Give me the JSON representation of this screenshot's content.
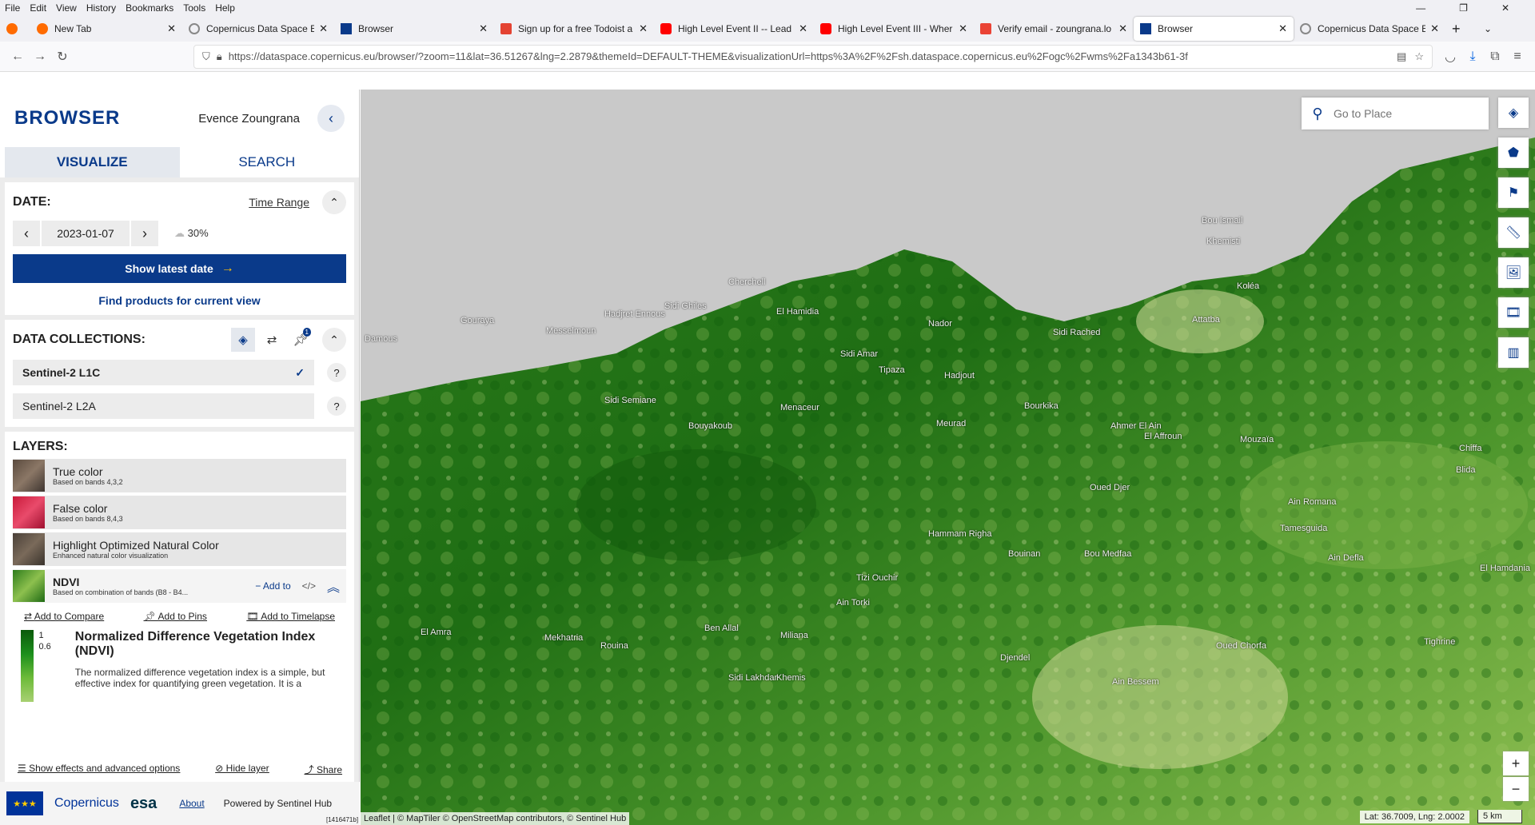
{
  "menu": [
    "File",
    "Edit",
    "View",
    "History",
    "Bookmarks",
    "Tools",
    "Help"
  ],
  "window_controls": [
    "—",
    "❐",
    "✕"
  ],
  "tabs": [
    {
      "label": "New Tab",
      "color": "#ff6b00"
    },
    {
      "label": "Copernicus Data Space Ec",
      "color": "#888"
    },
    {
      "label": "Browser",
      "color": "#0a3a8a"
    },
    {
      "label": "Sign up for a free Todoist a",
      "color": "#e44332"
    },
    {
      "label": "High Level Event II -- Lead",
      "color": "#ff0000"
    },
    {
      "label": "High Level Event III - Wher",
      "color": "#ff0000"
    },
    {
      "label": "Verify email - zoungrana.lo",
      "color": "#ea4335"
    },
    {
      "label": "Browser",
      "color": "#0a3a8a"
    },
    {
      "label": "Copernicus Data Space Ec",
      "color": "#888"
    }
  ],
  "url": "https://dataspace.copernicus.eu/browser/?zoom=11&lat=36.51267&lng=2.2879&themeId=DEFAULT-THEME&visualizationUrl=https%3A%2F%2Fsh.dataspace.copernicus.eu%2Fogc%2Fwms%2Fa1343b61-3f",
  "brand": {
    "title": "BROWSER",
    "user": "Evence Zoungrana"
  },
  "main_tabs": {
    "visualize": "VISUALIZE",
    "search": "SEARCH"
  },
  "date": {
    "label": "DATE:",
    "time_range": "Time Range",
    "value": "2023-01-07",
    "cloud": "30%",
    "show_latest": "Show latest date",
    "find": "Find products for current view"
  },
  "collections": {
    "label": "DATA COLLECTIONS:",
    "pin_count": "1",
    "items": [
      "Sentinel-2 L1C",
      "Sentinel-2 L2A"
    ]
  },
  "layers": {
    "label": "LAYERS:",
    "items": [
      {
        "name": "True color",
        "desc": "Based on bands 4,3,2"
      },
      {
        "name": "False color",
        "desc": "Based on bands 8,4,3"
      },
      {
        "name": "Highlight Optimized Natural Color",
        "desc": "Enhanced natural color visualization"
      },
      {
        "name": "NDVI",
        "desc": "Based on combination of bands (B8 - B4..."
      }
    ],
    "add_to": "Add to",
    "code": "</>",
    "actions": [
      "Add to Compare",
      "Add to Pins",
      "Add to Timelapse"
    ]
  },
  "legend": {
    "v1": "1",
    "v2": "0.6",
    "title": "Normalized Difference Vegetation Index (NDVI)",
    "text": "The normalized difference vegetation index is a simple, but effective index for quantifying green vegetation. It is a"
  },
  "bottom_links": {
    "effects": "Show effects and advanced options",
    "hide": "Hide layer",
    "share": "Share"
  },
  "footer": {
    "about": "About",
    "powered": "Powered by Sentinel Hub",
    "version": "[1416471b]"
  },
  "map": {
    "search_placeholder": "Go to Place",
    "attribution": "Leaflet | © MapTiler © OpenStreetMap contributors, © Sentinel Hub",
    "coords": "Lat: 36.7009, Lng: 2.0002",
    "scale": "5 km",
    "places": [
      "Cherchell",
      "Sidi Ghiles",
      "Hadjret Ennous",
      "Gouraya",
      "Messelmoun",
      "Damous",
      "Tipaza",
      "Nador",
      "El Hamidia",
      "Sidi Amar",
      "Bou Ismail",
      "Khemisti",
      "Koléa",
      "Attatba",
      "Hadjout",
      "Sidi Rached",
      "Menaceur",
      "Sidi Semiane",
      "Bouyakoub",
      "Ahmer El Ain",
      "El Affroun",
      "Mouzaïa",
      "Bourkika",
      "Meurad",
      "Oued Djer",
      "Hammam Righa",
      "Bouinan",
      "Ain Defla",
      "Tizi Ouchir",
      "Ain Torki",
      "Ben Allal",
      "Miliana",
      "Mekhatria",
      "El Amra",
      "Rouina",
      "Sidi Lakhdar",
      "Khemis",
      "Djendel",
      "Ain Bessem",
      "Bou Medfaa",
      "Tamesguida",
      "Ain Romana",
      "El Hamdania",
      "Chiffa",
      "Blida",
      "Tighrine",
      "Oued Chorfa"
    ]
  }
}
